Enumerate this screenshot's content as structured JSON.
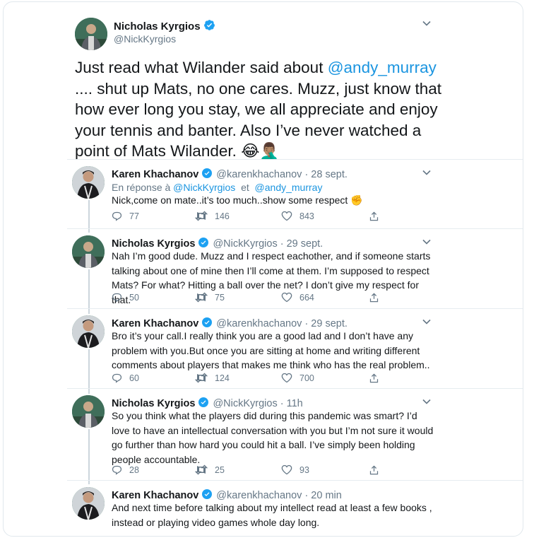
{
  "main_tweet": {
    "author_name": "Nicholas Kyrgios",
    "author_handle": "@NickKyrgios",
    "text_before": "Just read what Wilander said about ",
    "mention": "@andy_murray",
    "text_after": " .... shut up Mats, no one cares. Muzz, just know that how ever long you stay, we all appreciate and enjoy your tennis and banter. Also I’ve never watched a point of Mats Wilander. ",
    "emoji": "😂🤦🏽‍♂️"
  },
  "replies": [
    {
      "author_name": "Karen Khachanov",
      "meta": "@karenkhachanov · 28 sept.",
      "reply_to_prefix": "En réponse à ",
      "reply_to_1": "@NickKyrgios",
      "reply_to_mid": "  et  ",
      "reply_to_2": "@andy_murray",
      "text": "Nick,come on mate..it’s too much..show some respect ✊",
      "replies": "77",
      "retweets": "146",
      "likes": "843"
    },
    {
      "author_name": "Nicholas Kyrgios",
      "meta": "@NickKyrgios · 29 sept.",
      "text": "Nah I’m good dude. Muzz and I respect eachother, and if someone starts talking about one of mine then I’ll come at them. I’m supposed to respect Mats? For what? Hitting a ball over the net? I don’t give my respect for that.",
      "replies": "50",
      "retweets": "75",
      "likes": "664"
    },
    {
      "author_name": "Karen Khachanov",
      "meta": "@karenkhachanov · 29 sept.",
      "text": "Bro it’s your call.I really think you are a good lad and I don’t have any problem with you.But once you are sitting at home and writing different comments about players that makes me think who has the real problem..",
      "replies": "60",
      "retweets": "124",
      "likes": "700"
    },
    {
      "author_name": "Nicholas Kyrgios",
      "meta": "@NickKyrgios · 11h",
      "text": "So you think what the players did during this pandemic was smart? I’d love to have an intellectual conversation with you but I’m not sure it would go further than how hard you could hit a ball. I’ve simply been holding people accountable.",
      "replies": "28",
      "retweets": "25",
      "likes": "93"
    },
    {
      "author_name": "Karen Khachanov",
      "meta": "@karenkhachanov · 20 min",
      "text": "And next time before talking about my intellect read at least a few books , instead or playing video games whole day long."
    }
  ],
  "colors": {
    "accent": "#1b95e0",
    "verified": "#1da1f2",
    "muted": "#657786"
  }
}
